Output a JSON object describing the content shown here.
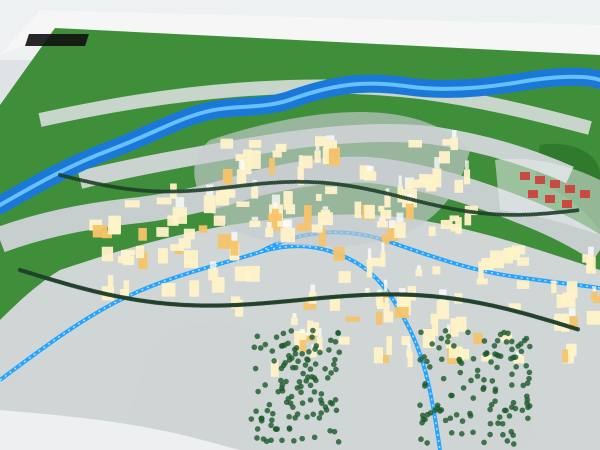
{
  "scene": {
    "subject": "urban-planning-model",
    "colors": {
      "grass": "#3f8f3a",
      "grass_dark": "#2f7a2c",
      "road": "#d7dadd",
      "river": "#1a78d8",
      "led_blue": "#1ea0ff",
      "building_lit": "#fff2c8",
      "building_warm": "#f6c46a",
      "red_roofs": "#c94a3f",
      "tree": "#1f3f2a",
      "table_edge": "#f7f7f7"
    }
  }
}
